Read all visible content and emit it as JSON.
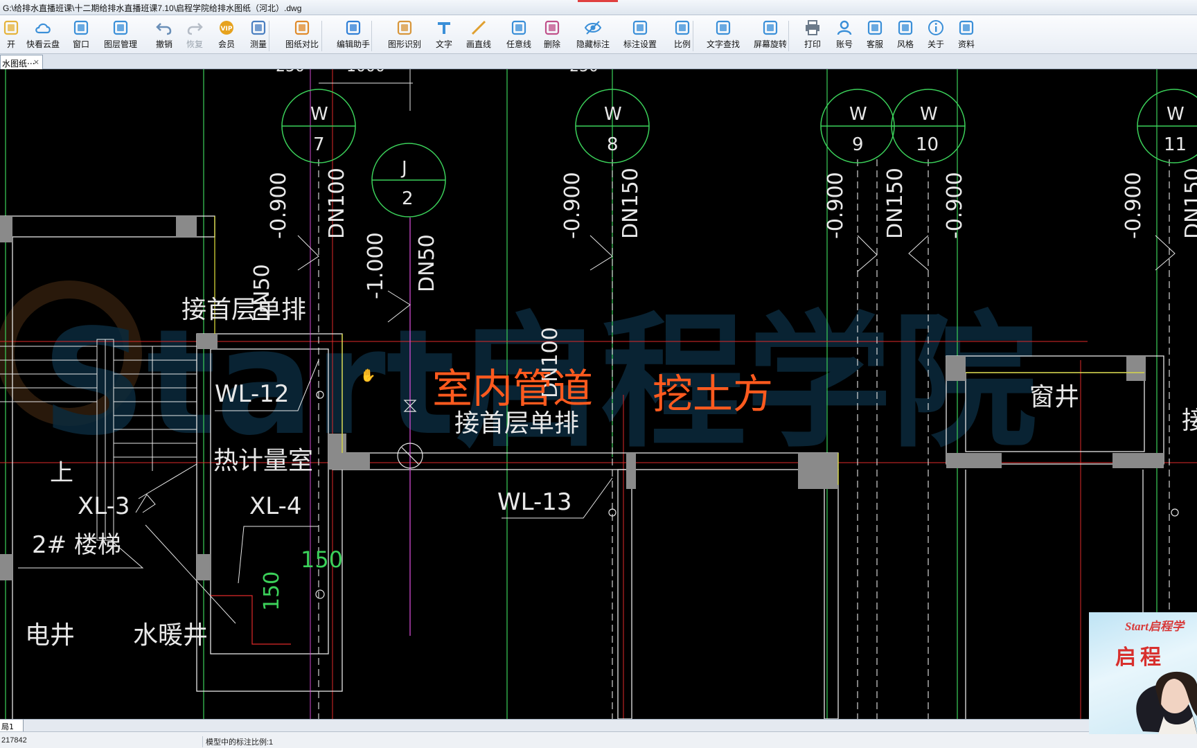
{
  "window": {
    "title": "G:\\给排水直播班课\\十二期给排水直播班课7.10\\启程学院给排水图纸（河北）.dwg"
  },
  "toolbar": {
    "items": [
      {
        "label": "开",
        "icon": "folder-icon"
      },
      {
        "label": "快看云盘",
        "icon": "cloud-icon"
      },
      {
        "label": "窗口",
        "icon": "window-icon"
      },
      {
        "label": "图层管理",
        "icon": "layers-icon"
      },
      {
        "label": "撤销",
        "icon": "undo-icon"
      },
      {
        "label": "恢复",
        "icon": "redo-icon"
      },
      {
        "label": "会员",
        "icon": "vip-icon"
      },
      {
        "label": "测量",
        "icon": "ruler-icon"
      },
      {
        "label": "图纸对比",
        "icon": "compare-icon"
      },
      {
        "label": "编辑助手",
        "icon": "edit-helper-icon"
      },
      {
        "label": "图形识别",
        "icon": "shape-recognize-icon"
      },
      {
        "label": "文字",
        "icon": "text-icon"
      },
      {
        "label": "画直线",
        "icon": "line-icon"
      },
      {
        "label": "任意线",
        "icon": "freehand-icon"
      },
      {
        "label": "删除",
        "icon": "eraser-icon"
      },
      {
        "label": "隐藏标注",
        "icon": "eye-icon"
      },
      {
        "label": "标注设置",
        "icon": "annotation-settings-icon"
      },
      {
        "label": "比例",
        "icon": "scale-icon"
      },
      {
        "label": "文字查找",
        "icon": "text-search-icon"
      },
      {
        "label": "屏幕旋转",
        "icon": "rotate-icon"
      },
      {
        "label": "打印",
        "icon": "printer-icon"
      },
      {
        "label": "账号",
        "icon": "user-icon"
      },
      {
        "label": "客服",
        "icon": "headset-icon"
      },
      {
        "label": "风格",
        "icon": "style-icon"
      },
      {
        "label": "关于",
        "icon": "info-icon"
      },
      {
        "label": "资料",
        "icon": "documents-icon"
      }
    ],
    "vip_text": "VIP"
  },
  "tabs": {
    "active": "水图纸···",
    "close": "×"
  },
  "drawing": {
    "bubbles": [
      {
        "top": "W",
        "bottom": "7"
      },
      {
        "top": "W",
        "bottom": "8"
      },
      {
        "top": "W",
        "bottom": "9"
      },
      {
        "top": "W",
        "bottom": "10"
      },
      {
        "top": "W",
        "bottom": "11"
      },
      {
        "top": "J",
        "bottom": "2"
      }
    ],
    "dims_top": [
      "250",
      "1000",
      "250"
    ],
    "elevations": [
      "-0.900",
      "-1.000"
    ],
    "pipes": [
      "DN50",
      "DN100",
      "DN150"
    ],
    "labels": {
      "connect_first_floor": "接首层单排",
      "wl12": "WL-12",
      "wl13": "WL-13",
      "heat_meter_room": "热计量室",
      "xl4": "XL-4",
      "xl3": "XL-3",
      "up": "上",
      "stair2": "2# 楼梯",
      "electric_well": "电井",
      "hvac_well": "水暖井",
      "window_well": "窗井",
      "dim150": "150",
      "connect_partial": "接"
    },
    "annotations": {
      "indoor_trench": "室内管道",
      "earthwork": "挖土方"
    },
    "watermark": "Start启程学院"
  },
  "layout_tab": "局1",
  "status": {
    "coords": "217842",
    "scale": "模型中的标注比例:1"
  },
  "webcam": {
    "brand": "Start启程学",
    "slogan": "启程"
  },
  "colors": {
    "grid_green": "#3bd15a",
    "axis_red": "#e02a2a",
    "magenta": "#d24ad2",
    "yellow": "#e6e63c",
    "wall_gray": "#8a8a8a",
    "annotation_orange": "#ff5a1e"
  }
}
